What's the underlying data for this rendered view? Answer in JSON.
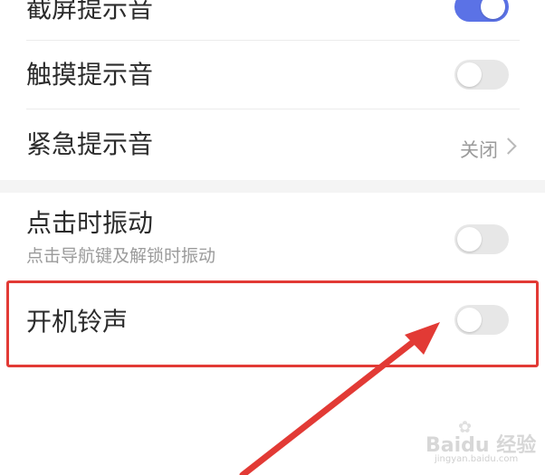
{
  "settings": {
    "screenshot_sound": {
      "label": "截屏提示音",
      "toggle_on": true
    },
    "touch_sound": {
      "label": "触摸提示音",
      "toggle_on": false
    },
    "emergency_sound": {
      "label": "紧急提示音",
      "value": "关闭"
    },
    "click_vibrate": {
      "label": "点击时振动",
      "description": "点击导航键及解锁时振动",
      "toggle_on": false
    },
    "boot_ringtone": {
      "label": "开机铃声",
      "toggle_on": false
    }
  },
  "annotation": {
    "highlight_color": "#e23a35",
    "arrow_color": "#e23a35"
  },
  "watermark": {
    "logo": "Baidu 经验",
    "url": "jingyan.baidu.com"
  },
  "colors": {
    "toggle_on": "#5b72e6",
    "toggle_off": "#e7e7e7"
  }
}
